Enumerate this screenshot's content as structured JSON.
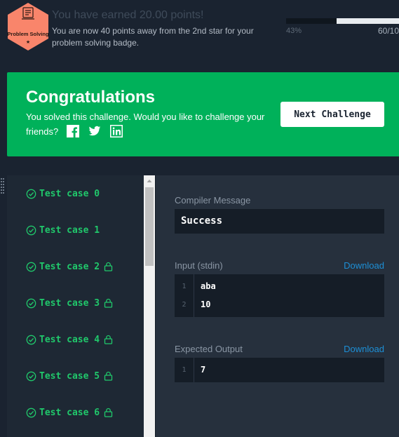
{
  "badge": {
    "label": "Problem Solving",
    "color": "#f9856b",
    "icon": "code-document-icon"
  },
  "points": {
    "title": "You have earned 20.00 points!",
    "subtitle": "You are now 40 points away from the 2nd star for your problem solving badge.",
    "progress_percent_label": "43%",
    "progress_fraction": 0.55,
    "progress_count": "60/10"
  },
  "congrats": {
    "title": "Congratulations",
    "message": "You solved this challenge. Would you like to challenge your friends?",
    "share": [
      "facebook-icon",
      "twitter-icon",
      "linkedin-icon"
    ],
    "next_button": "Next Challenge",
    "background": "#00b15a"
  },
  "test_cases": [
    {
      "label": "Test case 0",
      "locked": false
    },
    {
      "label": "Test case 1",
      "locked": false
    },
    {
      "label": "Test case 2",
      "locked": true
    },
    {
      "label": "Test case 3",
      "locked": true
    },
    {
      "label": "Test case 4",
      "locked": true
    },
    {
      "label": "Test case 5",
      "locked": true
    },
    {
      "label": "Test case 6",
      "locked": true
    }
  ],
  "compiler": {
    "label": "Compiler Message",
    "message": "Success"
  },
  "input": {
    "label": "Input (stdin)",
    "download": "Download",
    "lines": [
      {
        "num": "1",
        "text": "aba"
      },
      {
        "num": "2",
        "text": "10"
      }
    ]
  },
  "expected": {
    "label": "Expected Output",
    "download": "Download",
    "lines": [
      {
        "num": "1",
        "text": "7"
      }
    ]
  },
  "colors": {
    "accent_green": "#20c86b",
    "link_blue": "#1d8fd6"
  }
}
